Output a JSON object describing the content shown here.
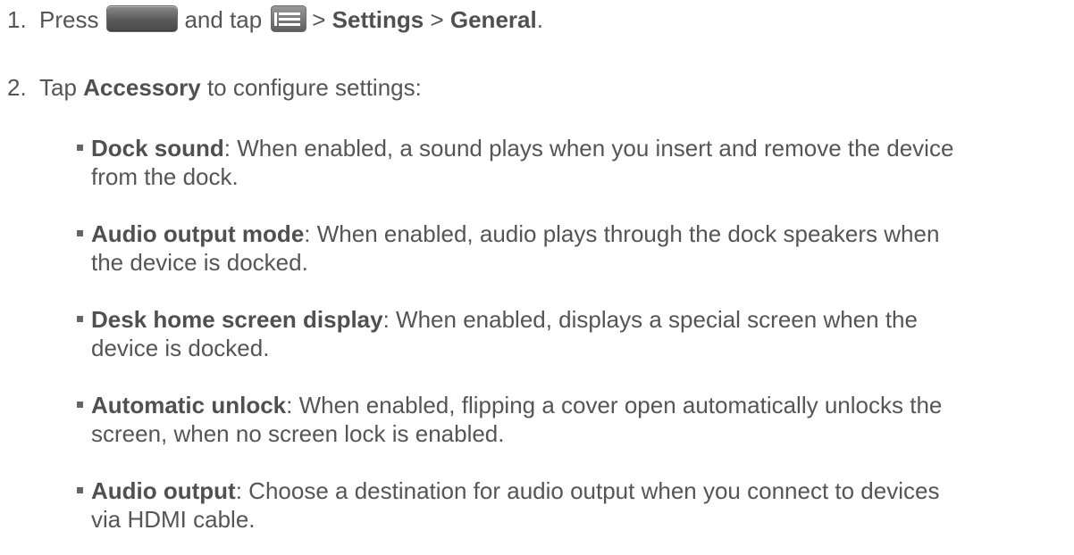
{
  "steps": [
    {
      "number": "1.",
      "press_word": "Press",
      "and_tap": "and tap",
      "sep1": ">",
      "settings": "Settings",
      "sep2": ">",
      "general": "General",
      "end": ".",
      "icons": [
        "home-key-icon",
        "menu-key-icon"
      ]
    },
    {
      "number": "2.",
      "tap_word": "Tap",
      "accessory": "Accessory",
      "rest": "to configure settings:"
    }
  ],
  "bullets": [
    {
      "term": "Dock sound",
      "line1": ": When enabled, a sound plays when you insert and remove the device",
      "line2": "from the dock."
    },
    {
      "term": "Audio output mode",
      "line1": ": When enabled, audio plays through the dock speakers when",
      "line2": "the device is docked."
    },
    {
      "term": "Desk home screen display",
      "line1": ": When enabled, displays a special screen when the",
      "line2": "device is docked."
    },
    {
      "term": "Automatic unlock",
      "line1": ": When enabled, flipping a cover open automatically unlocks the",
      "line2": "screen, when no screen lock is enabled."
    },
    {
      "term": "Audio output",
      "line1": ": Choose a destination for audio output when you connect to devices",
      "line2": "via HDMI cable."
    }
  ],
  "colors": {
    "text": "#555555",
    "bold_text": "#505050",
    "bullet": "#666666",
    "key_gray": "#6a6a6a"
  }
}
